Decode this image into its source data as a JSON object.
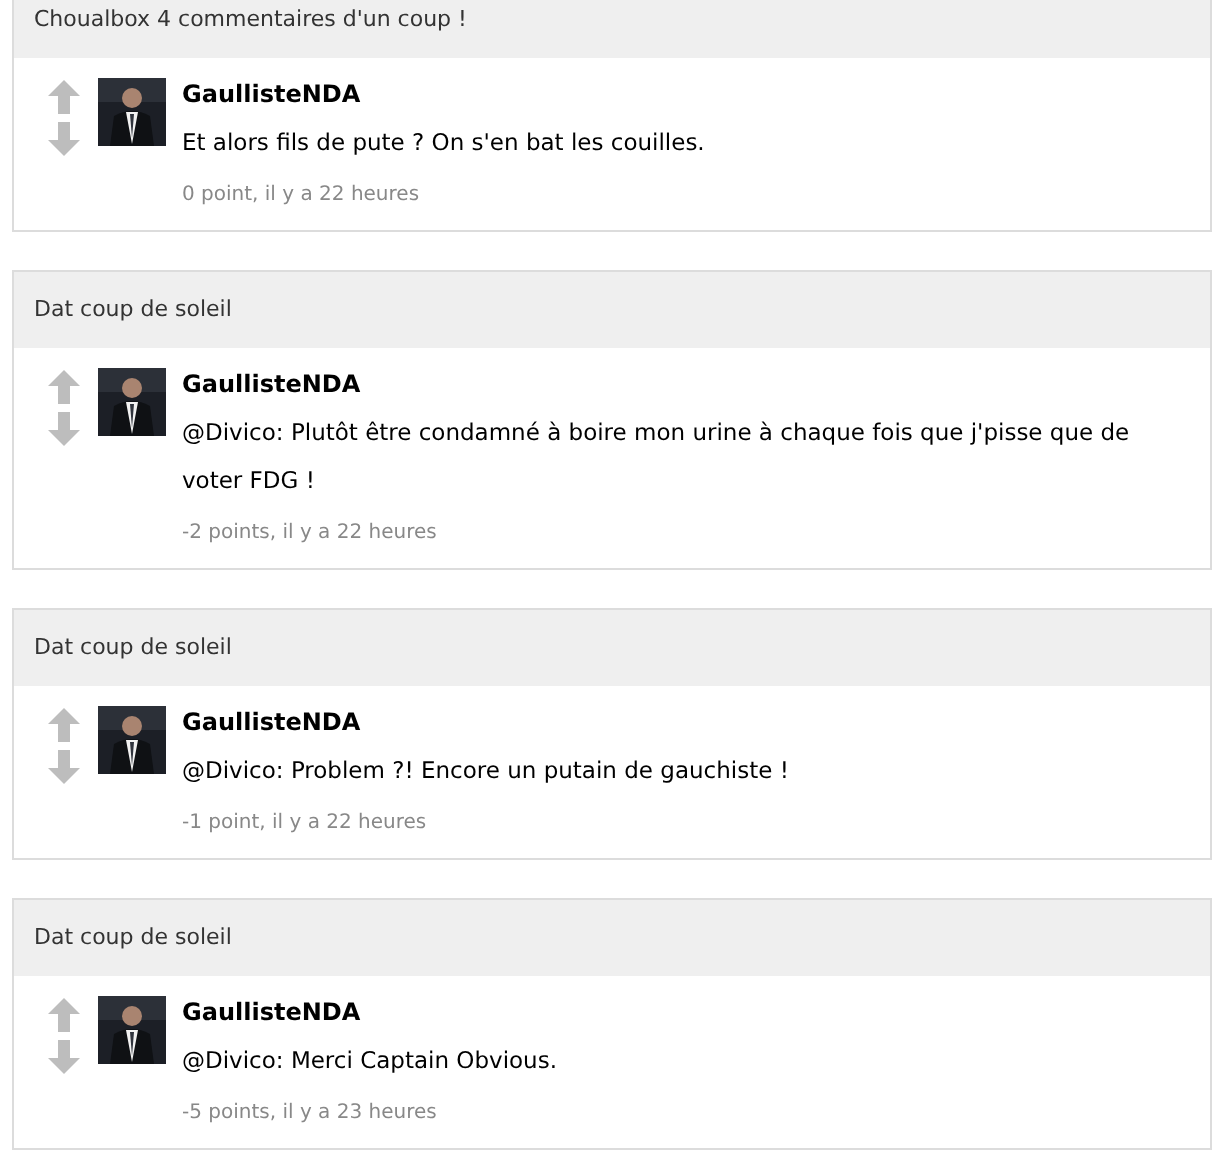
{
  "threads": [
    {
      "title": "Choualbox 4 commentaires d'un coup !",
      "comment": {
        "author": "GaullisteNDA",
        "text": "Et alors fils de pute ? On s'en bat les couilles.",
        "meta": "0 point, il y a 22 heures"
      }
    },
    {
      "title": "Dat coup de soleil",
      "comment": {
        "author": "GaullisteNDA",
        "text": "@Divico: Plutôt être condamné à boire mon urine à chaque fois que j'pisse que de voter FDG !",
        "meta": "-2 points, il y a 22 heures"
      }
    },
    {
      "title": "Dat coup de soleil",
      "comment": {
        "author": "GaullisteNDA",
        "text": "@Divico: Problem ?! Encore un putain de gauchiste !",
        "meta": "-1 point, il y a 22 heures"
      }
    },
    {
      "title": "Dat coup de soleil",
      "comment": {
        "author": "GaullisteNDA",
        "text": "@Divico: Merci Captain Obvious.",
        "meta": "-5 points, il y a 23 heures"
      }
    }
  ]
}
